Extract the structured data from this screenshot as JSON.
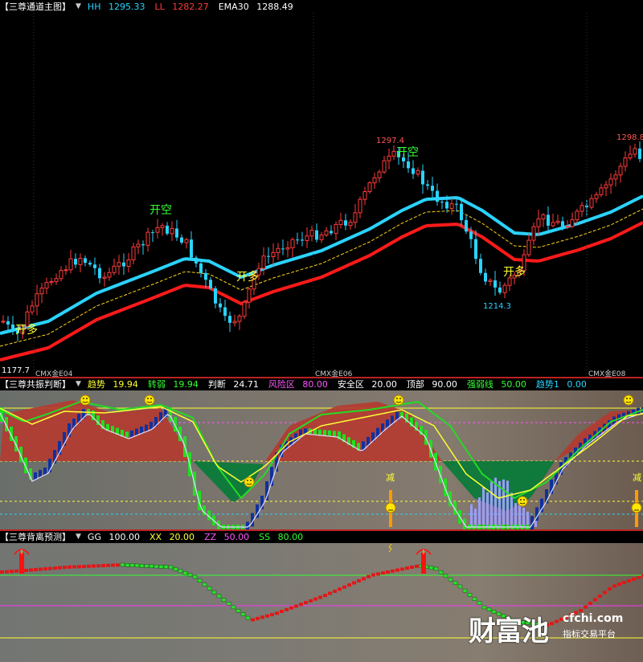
{
  "panel1": {
    "title": "【三尊通道主图】",
    "params": [
      {
        "label": "HH",
        "value": "1295.33",
        "color": "#2ad3ff"
      },
      {
        "label": "LL",
        "value": "1282.27",
        "color": "#ff3b3b"
      },
      {
        "label": "EMA30",
        "value": "1288.49",
        "color": "#ffffff"
      }
    ],
    "signals": [
      {
        "text": "开多",
        "color": "#ffff33"
      },
      {
        "text": "开空",
        "color": "#33ff33"
      },
      {
        "text": "开多",
        "color": "#ffff33"
      },
      {
        "text": "开空",
        "color": "#33ff33"
      },
      {
        "text": "开多",
        "color": "#ffff33"
      }
    ],
    "price_marks": [
      {
        "text": "1297.4",
        "color": "#ff5555"
      },
      {
        "text": "1214.3",
        "color": "#2ad3ff"
      },
      {
        "text": "1298.8",
        "color": "#ff5555"
      },
      {
        "text": "1177.7",
        "color": "#ffffff"
      }
    ],
    "contracts": [
      "CMX金E04",
      "CMX金E06",
      "CMX金E08"
    ]
  },
  "panel2": {
    "title": "【三尊共振判断】",
    "params": [
      {
        "label": "趋势",
        "value": "19.94",
        "color": "#ffff33"
      },
      {
        "label": "转弱",
        "value": "19.94",
        "color": "#33ff33"
      },
      {
        "label": "判断",
        "value": "24.71",
        "color": "#ffffff"
      },
      {
        "label": "风险区",
        "value": "80.00",
        "color": "#ff55ff"
      },
      {
        "label": "安全区",
        "value": "20.00",
        "color": "#ffffff"
      },
      {
        "label": "顶部",
        "value": "90.00",
        "color": "#ffffff"
      },
      {
        "label": "强弱线",
        "value": "50.00",
        "color": "#33ff33"
      },
      {
        "label": "趋势1",
        "value": "0.00",
        "color": "#2ad3ff"
      }
    ],
    "marks": [
      "减",
      "减"
    ]
  },
  "panel3": {
    "title": "【三尊背离预测】",
    "params": [
      {
        "label": "GG",
        "value": "100.00",
        "color": "#ffffff"
      },
      {
        "label": "XX",
        "value": "20.00",
        "color": "#ffff33"
      },
      {
        "label": "ZZ",
        "value": "50.00",
        "color": "#ff55ff"
      },
      {
        "label": "SS",
        "value": "80.00",
        "color": "#33ff33"
      }
    ]
  },
  "watermark": {
    "brand": "财富池",
    "domain": "cfchi.com",
    "tagline": "指标交易平台"
  },
  "colors": {
    "up": "#ff3b3b",
    "down": "#2ad3ff",
    "upper": "#2ad3ff",
    "lower": "#ff1a1a",
    "mid": "#ffd21a"
  }
}
